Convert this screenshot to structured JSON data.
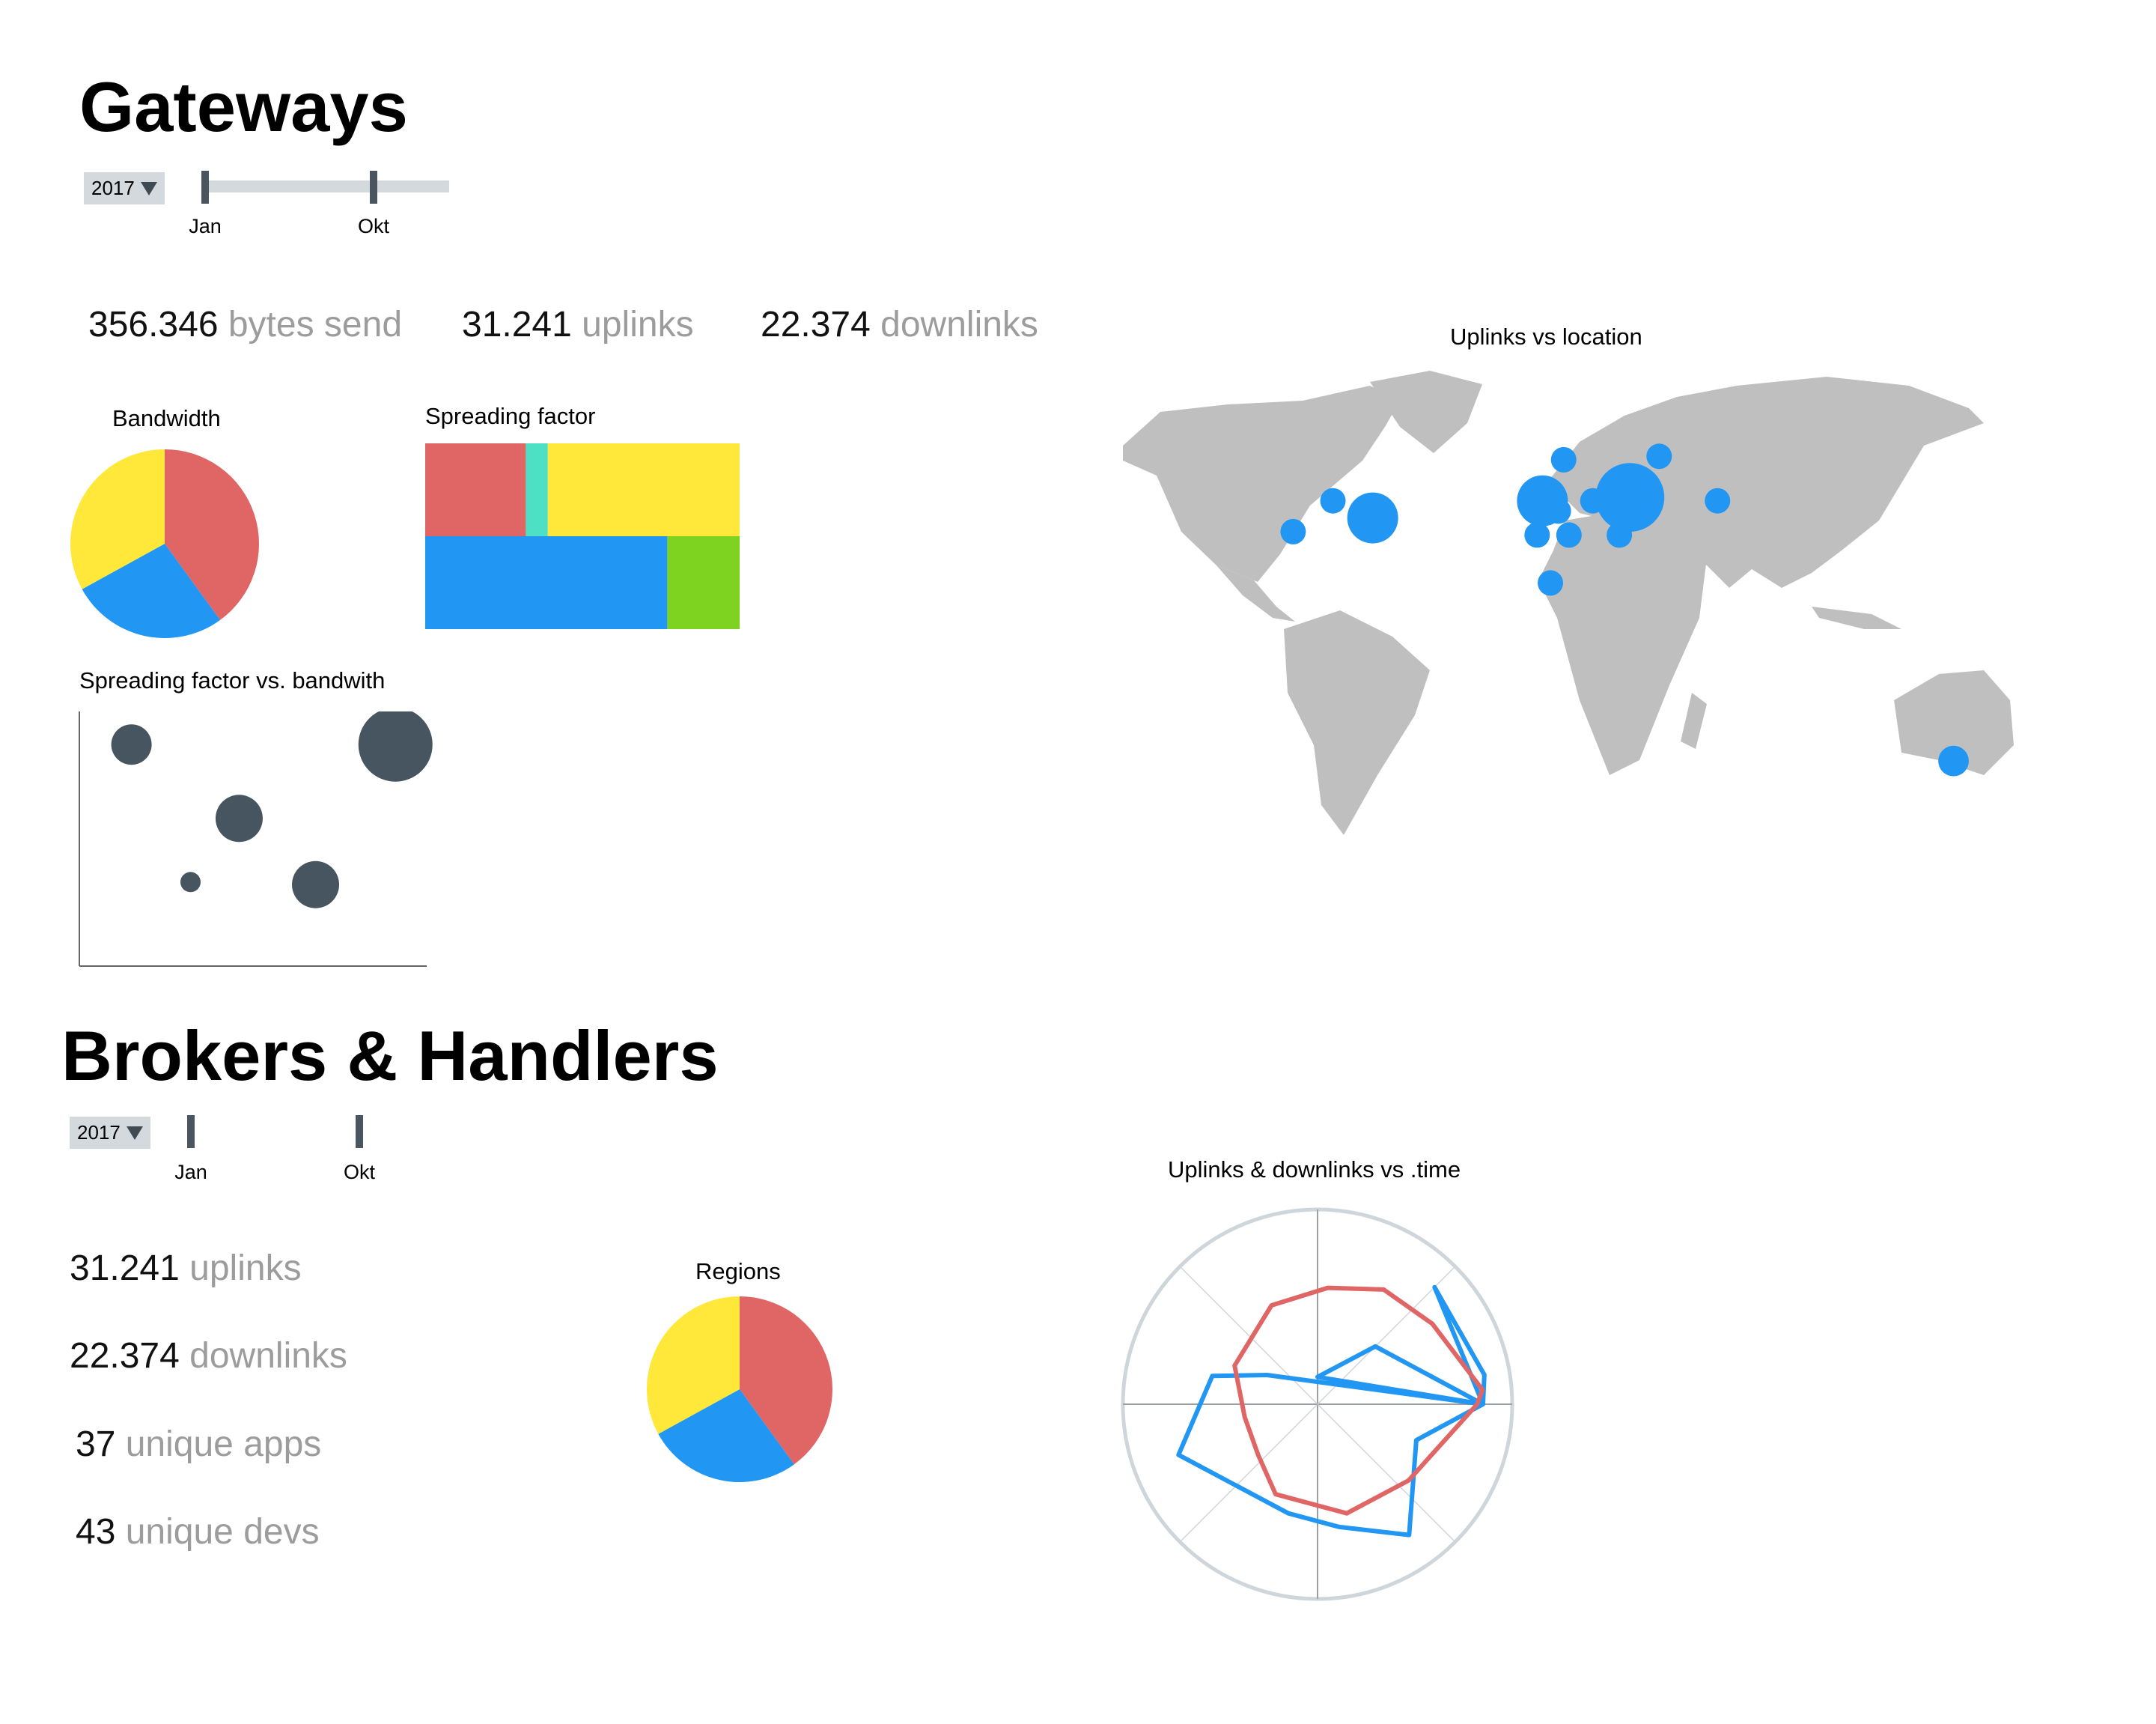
{
  "gateways": {
    "title": "Gateways",
    "year": "2017",
    "range_start_label": "Jan",
    "range_end_label": "Okt",
    "stats": [
      {
        "value": "356.346",
        "label": "bytes send"
      },
      {
        "value": "31.241",
        "label": "uplinks"
      },
      {
        "value": "22.374",
        "label": "downlinks"
      }
    ]
  },
  "brokers": {
    "title": "Brokers & Handlers",
    "year": "2017",
    "range_start_label": "Jan",
    "range_end_label": "Okt",
    "stats": [
      {
        "value": "31.241",
        "label": "uplinks"
      },
      {
        "value": "22.374",
        "label": "downlinks"
      },
      {
        "value": "37",
        "label": "unique apps"
      },
      {
        "value": "43",
        "label": "unique devs"
      }
    ]
  },
  "colors": {
    "red": "#e06666",
    "blue": "#2196f3",
    "yellow": "#ffe83a",
    "teal": "#4de0c4",
    "green": "#7ed321",
    "dark": "#465560",
    "land": "#bfbfbf"
  },
  "chart_data": [
    {
      "id": "bandwidth",
      "type": "pie",
      "title": "Bandwidth",
      "slices": [
        {
          "value": 40,
          "color": "#e06666"
        },
        {
          "value": 27,
          "color": "#2196f3"
        },
        {
          "value": 33,
          "color": "#ffe83a"
        }
      ]
    },
    {
      "id": "spreading-factor",
      "type": "treemap",
      "title": "Spreading factor",
      "rows": [
        [
          {
            "value": 32,
            "color": "#e06666"
          },
          {
            "value": 7,
            "color": "#4de0c4"
          },
          {
            "value": 61,
            "color": "#ffe83a"
          }
        ],
        [
          {
            "value": 77,
            "color": "#2196f3"
          },
          {
            "value": 23,
            "color": "#7ed321"
          }
        ]
      ]
    },
    {
      "id": "sf-vs-bandwidth",
      "type": "scatter",
      "title": "Spreading factor vs. bandwith",
      "xlim": [
        0,
        10
      ],
      "ylim": [
        0,
        10
      ],
      "points": [
        {
          "x": 1.5,
          "y": 8.7,
          "size": 3
        },
        {
          "x": 9.1,
          "y": 8.7,
          "size": 5.5
        },
        {
          "x": 4.6,
          "y": 5.8,
          "size": 3.5
        },
        {
          "x": 3.2,
          "y": 3.3,
          "size": 1.5
        },
        {
          "x": 6.8,
          "y": 3.2,
          "size": 3.5
        }
      ]
    },
    {
      "id": "uplinks-location",
      "type": "bubble-map",
      "title": "Uplinks vs location",
      "points": [
        {
          "lon": -88,
          "lat": 42,
          "size": 1
        },
        {
          "lon": -103,
          "lat": 33,
          "size": 1
        },
        {
          "lon": -73,
          "lat": 37,
          "size": 2
        },
        {
          "lon": -1,
          "lat": 54,
          "size": 1
        },
        {
          "lon": -9,
          "lat": 42,
          "size": 2
        },
        {
          "lon": -3,
          "lat": 39,
          "size": 1
        },
        {
          "lon": -11,
          "lat": 32,
          "size": 1
        },
        {
          "lon": 1,
          "lat": 32,
          "size": 1
        },
        {
          "lon": -6,
          "lat": 18,
          "size": 1
        },
        {
          "lon": 10,
          "lat": 42,
          "size": 1
        },
        {
          "lon": 24,
          "lat": 43,
          "size": 2.7
        },
        {
          "lon": 20,
          "lat": 32,
          "size": 1
        },
        {
          "lon": 35,
          "lat": 55,
          "size": 1
        },
        {
          "lon": 32,
          "lat": 42,
          "size": 1
        },
        {
          "lon": 57,
          "lat": 42,
          "size": 1
        },
        {
          "lon": 146,
          "lat": -34,
          "size": 1.2
        }
      ]
    },
    {
      "id": "regions",
      "type": "pie",
      "title": "Regions",
      "slices": [
        {
          "value": 40,
          "color": "#e06666"
        },
        {
          "value": 27,
          "color": "#2196f3"
        },
        {
          "value": 33,
          "color": "#ffe83a"
        }
      ]
    },
    {
      "id": "uplinks-downlinks-time",
      "type": "radar",
      "title": "Uplinks & downlinks vs .time",
      "rmax": 1,
      "series": [
        {
          "color": "#2196f3",
          "points": [
            {
              "angle": 0,
              "r": 0.85
            },
            {
              "angle": 350,
              "r": 0.87
            },
            {
              "angle": 315,
              "r": 0.85
            },
            {
              "angle": 0,
              "r": 0.85
            },
            {
              "angle": 270,
              "r": 0.14
            },
            {
              "angle": 315,
              "r": 0.42
            },
            {
              "angle": 0,
              "r": 0.85
            },
            {
              "angle": 20,
              "r": 0.54
            },
            {
              "angle": 55,
              "r": 0.82
            },
            {
              "angle": 80,
              "r": 0.64
            },
            {
              "angle": 105,
              "r": 0.58
            },
            {
              "angle": 160,
              "r": 0.76
            },
            {
              "angle": 195,
              "r": 0.56
            },
            {
              "angle": 210,
              "r": 0.3
            }
          ]
        },
        {
          "color": "#e06666",
          "points": [
            {
              "angle": 0,
              "r": 0.82
            },
            {
              "angle": 355,
              "r": 0.85
            },
            {
              "angle": 325,
              "r": 0.72
            },
            {
              "angle": 300,
              "r": 0.68
            },
            {
              "angle": 275,
              "r": 0.6
            },
            {
              "angle": 245,
              "r": 0.56
            },
            {
              "angle": 205,
              "r": 0.47
            },
            {
              "angle": 170,
              "r": 0.38
            },
            {
              "angle": 140,
              "r": 0.4
            },
            {
              "angle": 115,
              "r": 0.51
            },
            {
              "angle": 75,
              "r": 0.58
            },
            {
              "angle": 40,
              "r": 0.61
            }
          ]
        }
      ]
    }
  ]
}
